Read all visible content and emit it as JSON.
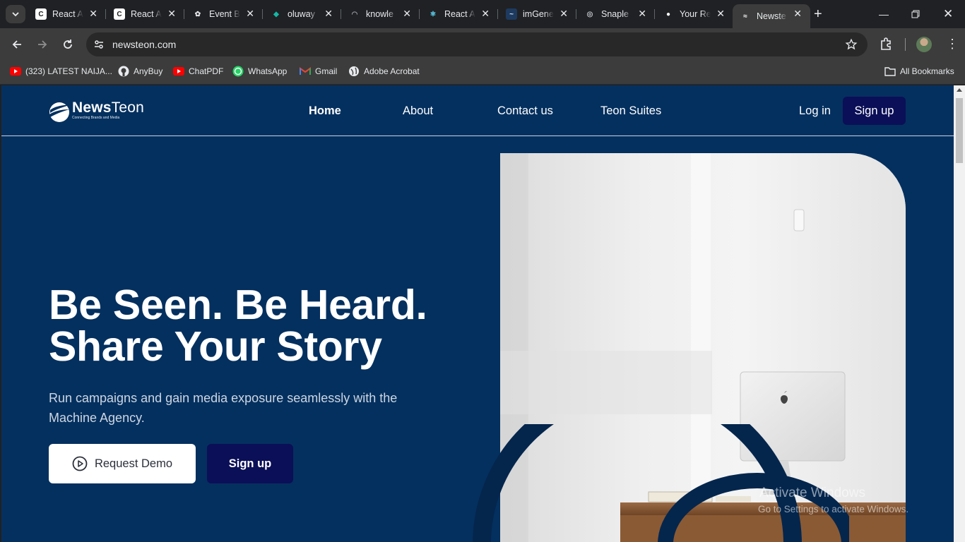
{
  "browser": {
    "tabs": [
      {
        "title": "React A",
        "favicon": "react-app-icon"
      },
      {
        "title": "React A",
        "favicon": "react-app-icon"
      },
      {
        "title": "Event B",
        "favicon": "openai-icon"
      },
      {
        "title": "oluway",
        "favicon": "diamond-icon"
      },
      {
        "title": "knowle",
        "favicon": "loading-spinner-icon"
      },
      {
        "title": "React A",
        "favicon": "react-icon"
      },
      {
        "title": "imGene",
        "favicon": "waveform-icon"
      },
      {
        "title": "Snaple",
        "favicon": "globe-icon"
      },
      {
        "title": "Your Re",
        "favicon": "github-icon"
      },
      {
        "title": "Newste",
        "favicon": "newsteon-icon",
        "active": true
      }
    ],
    "url": "newsteon.com",
    "bookmarks": [
      {
        "label": "(323) LATEST NAIJA...",
        "icon": "youtube-icon"
      },
      {
        "label": "AnyBuy",
        "icon": "github-icon"
      },
      {
        "label": "ChatPDF",
        "icon": "youtube-icon"
      },
      {
        "label": "WhatsApp",
        "icon": "whatsapp-icon"
      },
      {
        "label": "Gmail",
        "icon": "gmail-icon"
      },
      {
        "label": "Adobe Acrobat",
        "icon": "globe-icon"
      }
    ],
    "all_bookmarks": "All Bookmarks"
  },
  "site": {
    "logo": {
      "name_bold": "News",
      "name_light": "Teon",
      "tagline": "Connecting Brands and Media"
    },
    "nav": {
      "home": "Home",
      "about": "About",
      "contact": "Contact us",
      "suites": "Teon Suites",
      "login": "Log in",
      "signup": "Sign up"
    },
    "hero": {
      "title_line1": "Be Seen. Be Heard.",
      "title_line2": "Share Your Story",
      "subtitle": "Run campaigns and gain media exposure seamlessly with the Machine Agency.",
      "demo_button": "Request Demo",
      "signup_button": "Sign up"
    }
  },
  "os": {
    "watermark_title": "Activate Windows",
    "watermark_sub": "Go to Settings to activate Windows."
  },
  "colors": {
    "page_bg": "#04305f",
    "button_navy": "#0b0f57",
    "chrome_dark": "#202124",
    "chrome_toolbar": "#3c3c3c"
  }
}
